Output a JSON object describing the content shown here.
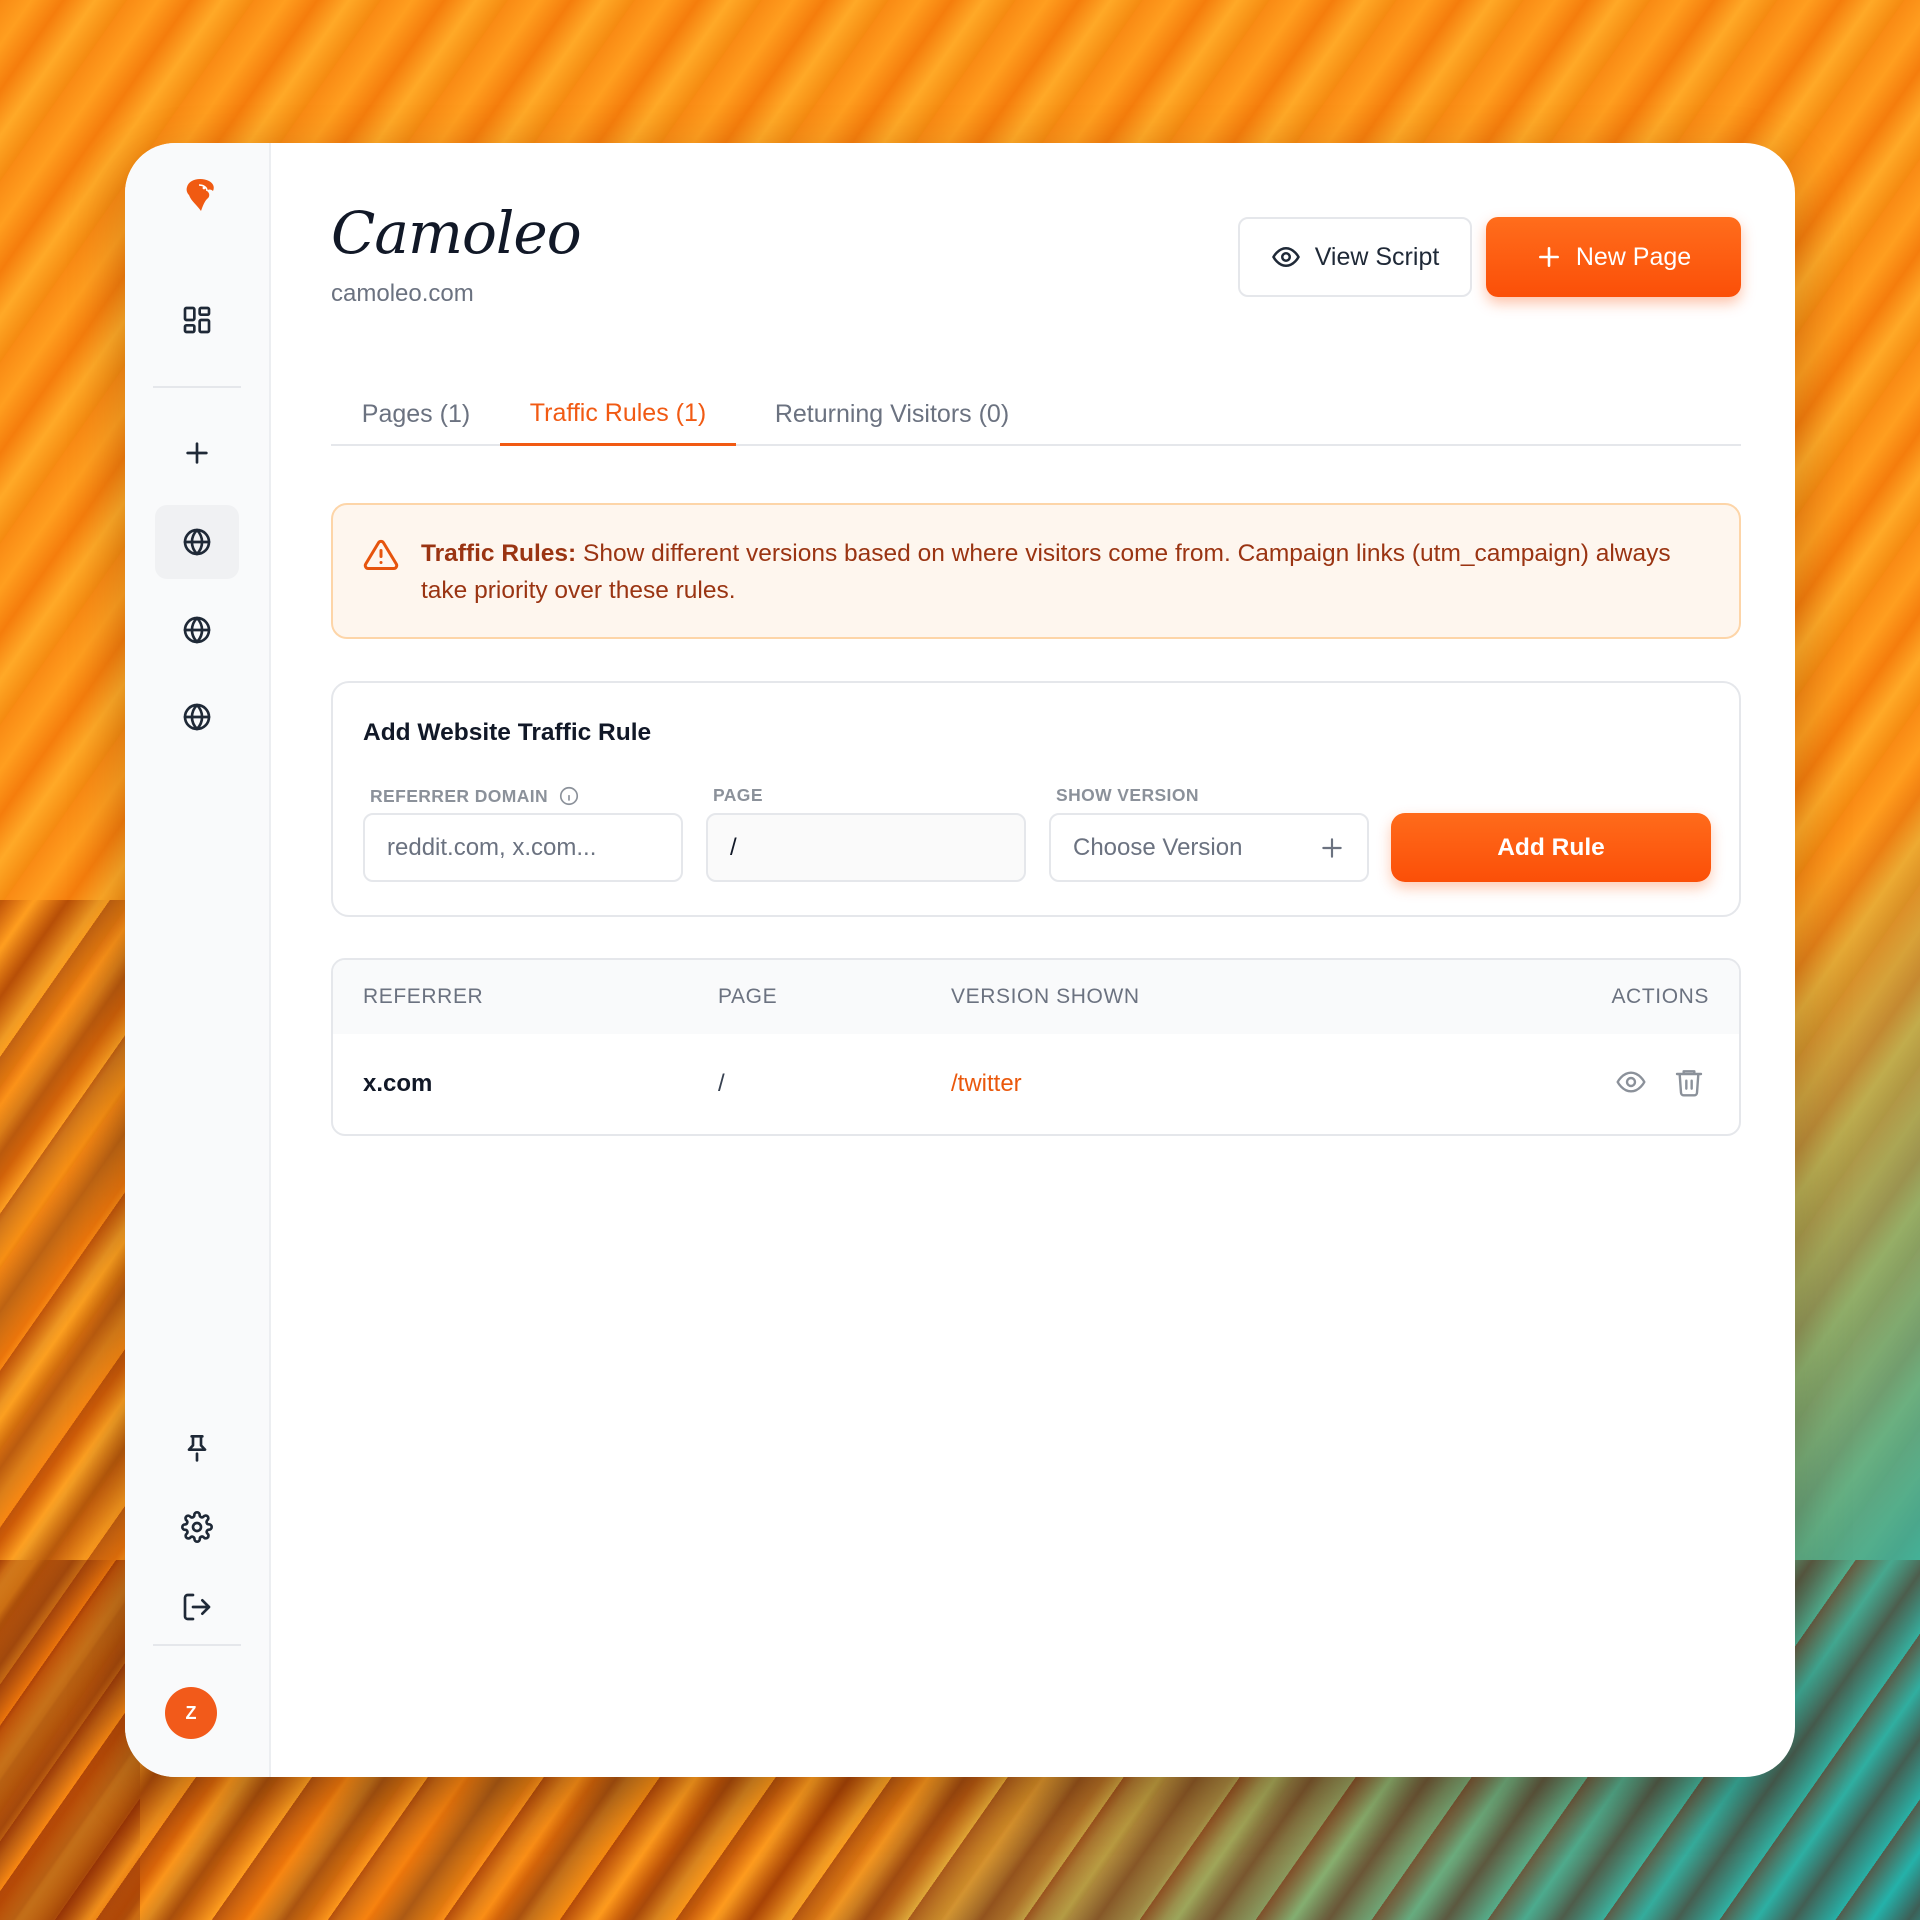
{
  "app": {
    "title": "Camoleo",
    "domain": "camoleo.com"
  },
  "header": {
    "view_script_label": "View Script",
    "new_page_label": "New Page"
  },
  "sidebar": {
    "items": [
      {
        "name": "dashboard",
        "icon": "grid-icon"
      },
      {
        "name": "add",
        "icon": "plus-icon"
      },
      {
        "name": "site-1",
        "icon": "globe-icon",
        "active": true
      },
      {
        "name": "site-2",
        "icon": "globe-icon"
      },
      {
        "name": "site-3",
        "icon": "globe-icon"
      },
      {
        "name": "pin",
        "icon": "pin-icon"
      },
      {
        "name": "settings",
        "icon": "gear-icon"
      },
      {
        "name": "logout",
        "icon": "logout-icon"
      }
    ],
    "avatar_initial": "Z"
  },
  "tabs": [
    {
      "label": "Pages (1)",
      "active": false
    },
    {
      "label": "Traffic Rules (1)",
      "active": true
    },
    {
      "label": "Returning Visitors (0)",
      "active": false
    }
  ],
  "alert": {
    "title": "Traffic Rules:",
    "message": "Show different versions based on where visitors come from. Campaign links (utm_campaign) always take priority over these rules."
  },
  "form": {
    "title": "Add Website Traffic Rule",
    "referrer_label": "REFERRER DOMAIN",
    "referrer_placeholder": "reddit.com, x.com...",
    "page_label": "PAGE",
    "page_value": "/",
    "version_label": "SHOW VERSION",
    "version_placeholder": "Choose Version",
    "submit_label": "Add Rule"
  },
  "table": {
    "columns": [
      "REFERRER",
      "PAGE",
      "VERSION SHOWN",
      "ACTIONS"
    ],
    "rows": [
      {
        "referrer": "x.com",
        "page": "/",
        "version": "/twitter"
      }
    ]
  },
  "colors": {
    "accent": "#fb4f08",
    "alert_bg": "#fef6ee",
    "alert_text": "#9a3412"
  }
}
